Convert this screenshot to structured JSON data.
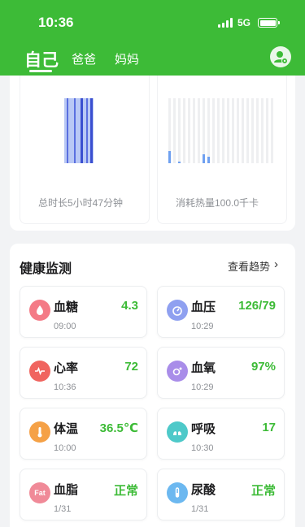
{
  "status_bar": {
    "time": "10:36",
    "network": "5G"
  },
  "tabs": [
    {
      "label": "自己",
      "active": true
    },
    {
      "label": "爸爸",
      "active": false
    },
    {
      "label": "妈妈",
      "active": false
    }
  ],
  "sleep_card": {
    "label": "总时长5小时47分钟"
  },
  "calorie_card": {
    "label": "消耗热量100.0千卡"
  },
  "health": {
    "title": "健康监测",
    "trend_label": "查看趋势",
    "items": [
      {
        "name": "血糖",
        "value": "4.3",
        "time": "09:00",
        "icon": "blood-drop-icon",
        "color": "#f47a86"
      },
      {
        "name": "血压",
        "value": "126/79",
        "time": "10:29",
        "icon": "gauge-icon",
        "color": "#8fa0f0"
      },
      {
        "name": "心率",
        "value": "72",
        "time": "10:36",
        "icon": "heart-icon",
        "color": "#f0645f"
      },
      {
        "name": "血氧",
        "value": "97%",
        "time": "10:29",
        "icon": "oxygen-drop-icon",
        "color": "#a98de9"
      },
      {
        "name": "体温",
        "value": "36.5℃",
        "time": "10:00",
        "icon": "thermometer-icon",
        "color": "#f5a146"
      },
      {
        "name": "呼吸",
        "value": "17",
        "time": "10:30",
        "icon": "lungs-icon",
        "color": "#4ec9c9"
      },
      {
        "name": "血脂",
        "value": "正常",
        "time": "1/31",
        "icon": "fat-drop-icon",
        "color": "#f08a98",
        "icon_text": "Fat"
      },
      {
        "name": "尿酸",
        "value": "正常",
        "time": "1/31",
        "icon": "test-tube-icon",
        "color": "#6cb8f0"
      }
    ]
  },
  "colors": {
    "brand_green": "#3dbb37"
  }
}
